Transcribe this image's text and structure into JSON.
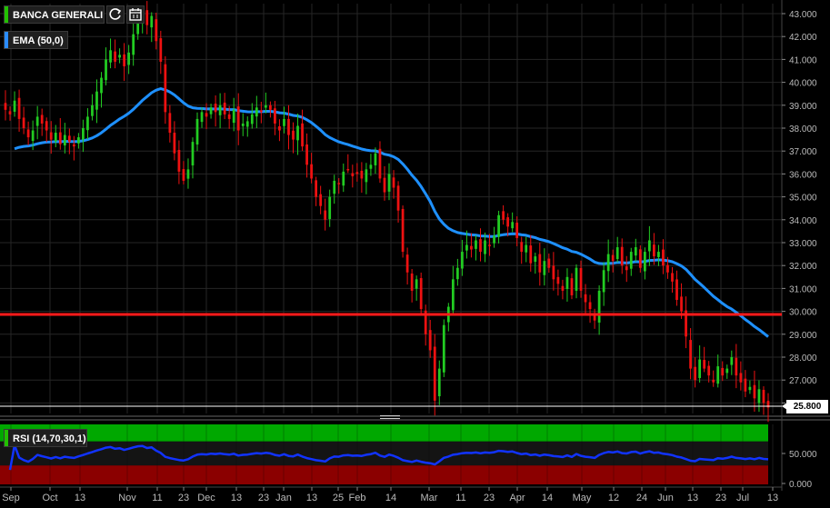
{
  "app": {
    "symbol": "BANCA GENERALI",
    "last_price": "25.800"
  },
  "colors": {
    "background": "#000000",
    "grid": "#262626",
    "axis_text": "#bbbbbb",
    "up_candle": "#22cc22",
    "down_candle": "#ee1111",
    "ema_line": "#1e90ff",
    "support_line": "#ff1a1a",
    "rsi_line": "#1133ff",
    "rsi_overbought_zone": "#00a800",
    "rsi_oversold_zone": "#8b0000",
    "rsi_mid_zone": "#141414"
  },
  "icons": {
    "refresh": "refresh-icon",
    "calendar": "calendar-icon",
    "splitter": "drag-handle-icon"
  },
  "chart_data": [
    {
      "type": "candlestick",
      "title": "BANCA GENERALI",
      "indicator_label": "EMA (50,0)",
      "grid": true,
      "ylim": [
        25.0,
        43.4
      ],
      "y_ticks": [
        "43.000",
        "42.000",
        "41.000",
        "40.000",
        "39.000",
        "38.000",
        "37.000",
        "36.000",
        "35.000",
        "34.000",
        "33.000",
        "32.000",
        "31.000",
        "30.000",
        "29.000",
        "28.000",
        "27.000",
        "26.000"
      ],
      "x_tick_labels": [
        "Sep",
        "Oct",
        "13",
        "Nov",
        "11",
        "23",
        "Dec",
        "13",
        "23",
        "Jan",
        "13",
        "25",
        "Feb",
        "14",
        "Mar",
        "11",
        "23",
        "Apr",
        "14",
        "May",
        "12",
        "24",
        "Jun",
        "13",
        "23",
        "Jul",
        "13"
      ],
      "closes": [
        38.8,
        38.6,
        39.2,
        38.4,
        38.0,
        37.6,
        37.9,
        38.5,
        38.2,
        37.9,
        37.5,
        37.8,
        37.3,
        37.7,
        37.4,
        37.2,
        37.6,
        38.0,
        38.5,
        39.0,
        39.6,
        40.2,
        41.0,
        41.4,
        40.9,
        41.2,
        40.7,
        41.3,
        42.1,
        42.8,
        43.1,
        42.5,
        42.9,
        41.8,
        40.9,
        38.7,
        37.8,
        36.9,
        36.1,
        35.7,
        36.2,
        37.4,
        38.4,
        38.7,
        38.5,
        38.9,
        38.7,
        39.0,
        38.6,
        38.4,
        38.8,
        37.9,
        38.2,
        38.3,
        38.6,
        38.9,
        38.7,
        39.0,
        38.8,
        38.2,
        37.9,
        38.4,
        37.7,
        37.5,
        38.1,
        37.2,
        36.4,
        35.8,
        35.0,
        34.6,
        34.0,
        35.0,
        35.7,
        35.6,
        36.1,
        36.2,
        35.9,
        36.0,
        35.8,
        36.2,
        36.4,
        36.9,
        35.8,
        35.2,
        36.0,
        35.4,
        34.4,
        32.6,
        31.7,
        30.9,
        31.4,
        30.1,
        29.0,
        28.3,
        26.1,
        27.5,
        29.4,
        30.2,
        31.4,
        31.9,
        32.6,
        32.9,
        32.7,
        33.1,
        32.6,
        33.1,
        32.9,
        33.3,
        34.2,
        34.0,
        33.7,
        33.9,
        33.2,
        32.6,
        32.9,
        32.1,
        32.4,
        31.7,
        32.2,
        31.9,
        31.4,
        31.2,
        30.9,
        31.5,
        30.7,
        31.9,
        30.9,
        30.4,
        30.1,
        29.6,
        30.9,
        31.8,
        32.5,
        32.2,
        32.8,
        32.0,
        31.8,
        32.6,
        32.8,
        31.9,
        32.6,
        33.1,
        32.4,
        32.6,
        32.0,
        31.7,
        31.3,
        30.5,
        30.0,
        28.9,
        27.5,
        27.0,
        27.9,
        27.5,
        27.2,
        26.9,
        27.6,
        27.2,
        27.5,
        28.0,
        27.2,
        26.9,
        26.5,
        26.7,
        26.2,
        26.6,
        26.0,
        25.8
      ]
    },
    {
      "type": "line",
      "title": "RSI (14,70,30,1)",
      "ylim": [
        0,
        100
      ],
      "y_ticks": [
        "50.000",
        "0.000"
      ],
      "zones": {
        "overbought": 70,
        "oversold": 30
      },
      "x_tick_labels": [
        "Sep",
        "Oct",
        "13",
        "Nov",
        "11",
        "23",
        "Dec",
        "13",
        "23",
        "Jan",
        "13",
        "25",
        "Feb",
        "14",
        "Mar",
        "11",
        "23",
        "Apr",
        "14",
        "May",
        "12",
        "24",
        "Jun",
        "13",
        "23",
        "Jul",
        "13"
      ]
    }
  ]
}
